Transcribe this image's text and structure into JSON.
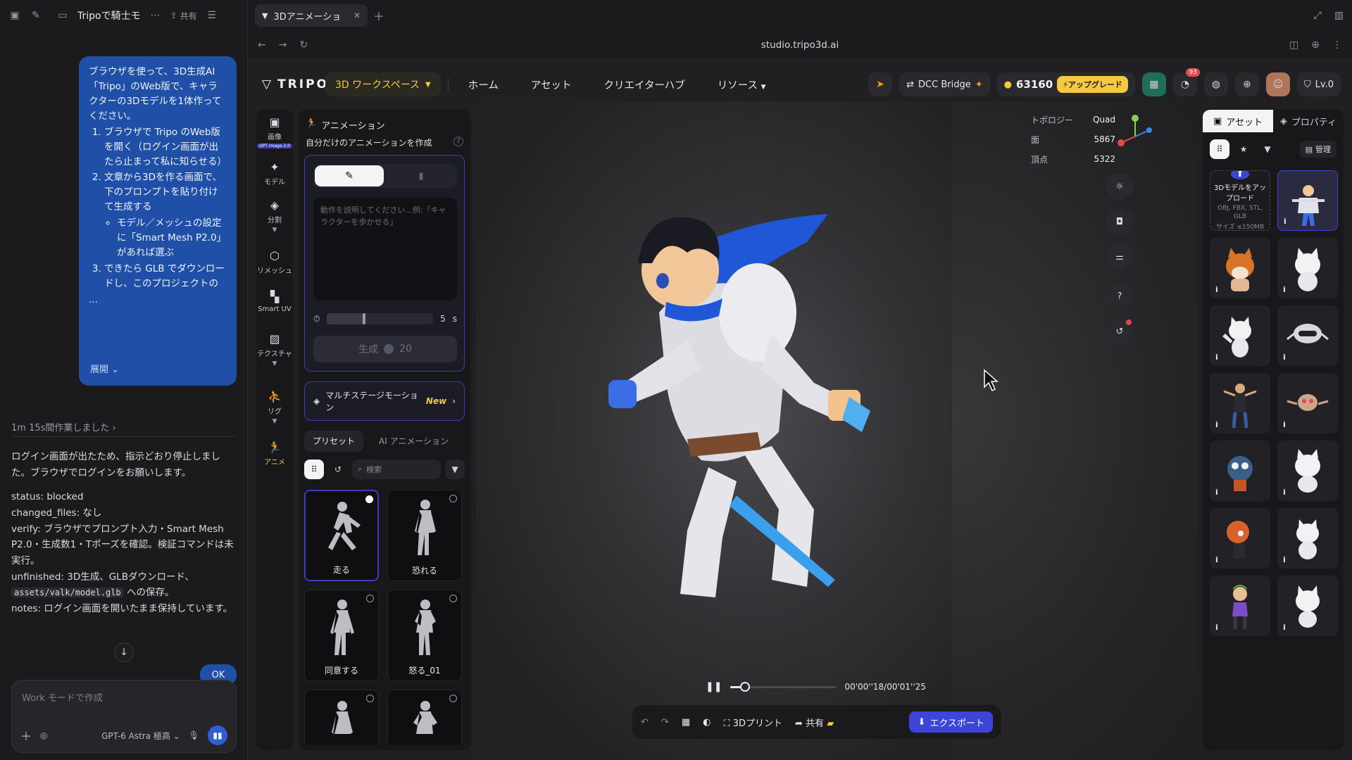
{
  "chat": {
    "title": "Tripoで騎士モ",
    "share": "共有",
    "bubble": {
      "intro": "ブラウザを使って、3D生成AI「Tripo」のWeb版で、キャラクターの3Dモデルを1体作ってください。",
      "steps": [
        "ブラウザで Tripo のWeb版を開く（ログイン画面が出たら止まって私に知らせる）",
        "文章から3Dを作る画面で、下のプロンプトを貼り付けて生成する",
        "できたら GLB でダウンロードし、このプロジェクトの"
      ],
      "substep": "モデル／メッシュの設定に「Smart Mesh P2.0」があれば選ぶ",
      "ellipsis": "...",
      "expand": "展開"
    },
    "worked": "1m 15s間作業しました",
    "report": {
      "line1": "ログイン画面が出たため、指示どおり停止しました。ブラウザでログインをお願いします。",
      "status": "status: blocked",
      "changed": "changed_files: なし",
      "verify": "verify: ブラウザでプロンプト入力・Smart Mesh P2.0・生成数1・Tポーズを確認。検証コマンドは未実行。",
      "unfinished_a": "unfinished: 3D生成、GLBダウンロード、",
      "unfinished_code": "assets/valk/model.glb",
      "unfinished_b": " への保存。",
      "notes": "notes: ログイン画面を開いたまま保持しています。"
    },
    "ok": "OK",
    "composer_placeholder": "Work モードで作成",
    "model": "GPT-6 Astra 極高"
  },
  "browser": {
    "tab_title": "3Dアニメーショ",
    "url": "studio.tripo3d.ai"
  },
  "nav": {
    "logo": "TRIPO",
    "workspace": "3D ワークスペース",
    "links": [
      "ホーム",
      "アセット",
      "クリエイターハブ",
      "リソース"
    ],
    "dcc": "DCC Bridge",
    "credits": "63160",
    "upgrade": "アップグレード",
    "notif_count": "93",
    "level": "Lv.0"
  },
  "rail": [
    {
      "label": "画像",
      "chip": "GPT image 2.0"
    },
    {
      "label": "モデル"
    },
    {
      "label": "分割"
    },
    {
      "label": "リメッシュ"
    },
    {
      "label": "Smart UV"
    },
    {
      "label": "テクスチャ"
    },
    {
      "label": "リグ"
    },
    {
      "label": "アニメ"
    }
  ],
  "panel": {
    "title": "アニメーション",
    "subtitle": "自分だけのアニメーションを作成",
    "prompt_placeholder": "動作を説明してください...例:「キャラクターを歩かせる」",
    "duration_value": "5",
    "duration_unit": "s",
    "duration_fraction": 0.35,
    "generate": "生成",
    "generate_cost": "20",
    "multistage": "マルチステージモーション",
    "new": "New",
    "tabs": [
      "プリセット",
      "AI アニメーション"
    ],
    "search_placeholder": "検索",
    "presets": [
      "走る",
      "恐れる",
      "同意する",
      "怒る_01",
      "",
      ""
    ]
  },
  "viewport": {
    "stats": [
      {
        "k": "トポロジー",
        "v": "Quad"
      },
      {
        "k": "面",
        "v": "5867"
      },
      {
        "k": "頂点",
        "v": "5322"
      }
    ],
    "time": "00'00''18/00'01''25",
    "progress": 0.14,
    "print3d": "3Dプリント",
    "share": "共有",
    "export": "エクスポート"
  },
  "assets": {
    "tabs": [
      "アセット",
      "プロパティ"
    ],
    "manage": "管理",
    "upload_title": "3Dモデルをアップロード",
    "upload_formats": "OBJ, FBX, STL, GLB",
    "upload_size": "サイズ ≤150MB",
    "info": "i"
  }
}
